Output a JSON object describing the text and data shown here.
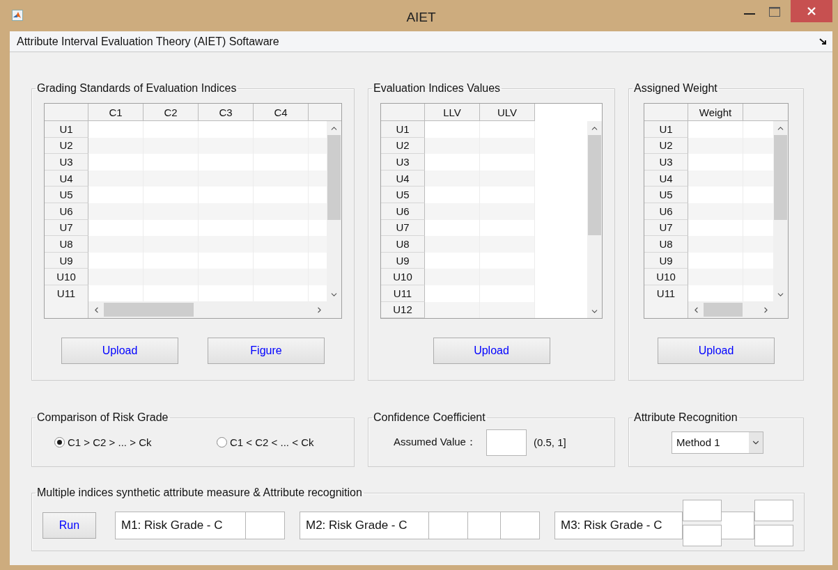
{
  "window": {
    "title": "AIET"
  },
  "toolbar": {
    "title": "Attribute Interval Evaluation Theory (AIET) Softaware"
  },
  "panels": [
    {
      "title": "Grading Standards of Evaluation Indices",
      "table": {
        "columns": [
          "C1",
          "C2",
          "C3",
          "C4"
        ],
        "rows": [
          "U1",
          "U2",
          "U3",
          "U4",
          "U5",
          "U6",
          "U7",
          "U8",
          "U9",
          "U10",
          "U11"
        ]
      },
      "buttons": [
        "Upload",
        "Figure"
      ]
    },
    {
      "title": "Evaluation Indices Values",
      "table": {
        "columns": [
          "LLV",
          "ULV"
        ],
        "rows": [
          "U1",
          "U2",
          "U3",
          "U4",
          "U5",
          "U6",
          "U7",
          "U8",
          "U9",
          "U10",
          "U11",
          "U12"
        ]
      },
      "buttons": [
        "Upload"
      ]
    },
    {
      "title": "Assigned Weight",
      "table": {
        "columns": [
          "Weight"
        ],
        "rows": [
          "U1",
          "U2",
          "U3",
          "U4",
          "U5",
          "U6",
          "U7",
          "U8",
          "U9",
          "U10",
          "U11"
        ]
      },
      "buttons": [
        "Upload"
      ]
    }
  ],
  "comparison": {
    "title": "Comparison of Risk Grade",
    "options": [
      {
        "label": "C1 > C2 > ... > Ck",
        "selected": true
      },
      {
        "label": "C1 < C2 < ... < Ck",
        "selected": false
      }
    ]
  },
  "confidence": {
    "title": "Confidence Coefficient",
    "label": "Assumed Value：",
    "range": "(0.5, 1]"
  },
  "recognition": {
    "title": "Attribute Recognition",
    "select": {
      "value": "Method 1"
    }
  },
  "synthetic": {
    "title": "Multiple indices synthetic attribute measure & Attribute recognition",
    "button": "Run",
    "results": [
      {
        "label": "M1: Risk Grade - C"
      },
      {
        "label": "M2: Risk Grade - C"
      },
      {
        "label": "M3: Risk Grade - C"
      }
    ]
  }
}
